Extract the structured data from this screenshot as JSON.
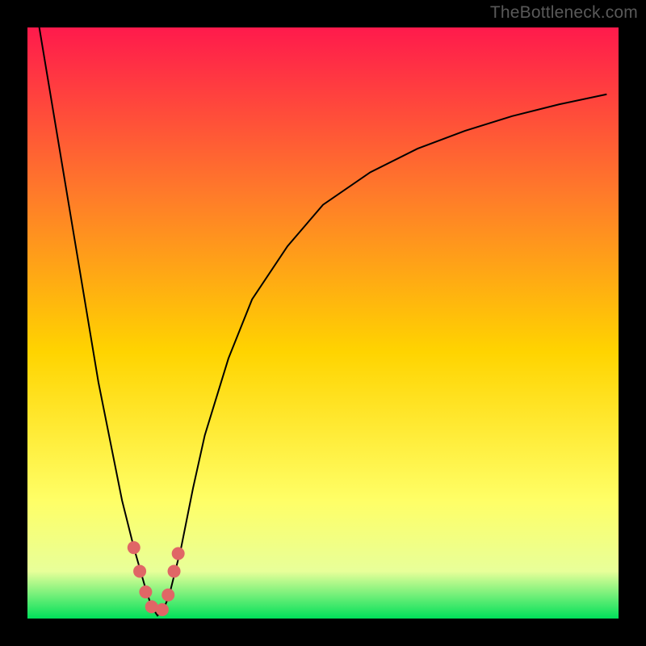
{
  "watermark": "TheBottleneck.com",
  "chart_data": {
    "type": "line",
    "title": "",
    "xlabel": "",
    "ylabel": "",
    "xlim": [
      0,
      100
    ],
    "ylim": [
      0,
      100
    ],
    "background_gradient": {
      "top": "#ff1a4c",
      "upper_mid": "#ff7a2a",
      "mid": "#ffd400",
      "lower_mid": "#ffff66",
      "lower": "#e8ff99",
      "bottom": "#00e05a"
    },
    "series": [
      {
        "name": "bottleneck-curve",
        "x": [
          2,
          4,
          6,
          8,
          10,
          12,
          14,
          16,
          18,
          20,
          21,
          22,
          23,
          24,
          26,
          28,
          30,
          34,
          38,
          44,
          50,
          58,
          66,
          74,
          82,
          90,
          98
        ],
        "y": [
          100,
          88,
          76,
          64,
          52,
          40,
          30,
          20,
          12,
          5,
          2,
          0.5,
          1.5,
          4,
          12,
          22,
          31,
          44,
          54,
          63,
          70,
          75.5,
          79.5,
          82.5,
          85,
          87,
          88.7
        ],
        "stroke": "#000000",
        "stroke_width": 2
      }
    ],
    "markers": {
      "name": "highlight-markers",
      "color": "#e06666",
      "radius": 8,
      "points": [
        {
          "x": 18.0,
          "y": 12.0
        },
        {
          "x": 19.0,
          "y": 8.0
        },
        {
          "x": 20.0,
          "y": 4.5
        },
        {
          "x": 21.0,
          "y": 2.0
        },
        {
          "x": 22.8,
          "y": 1.5
        },
        {
          "x": 23.8,
          "y": 4.0
        },
        {
          "x": 24.8,
          "y": 8.0
        },
        {
          "x": 25.5,
          "y": 11.0
        }
      ]
    }
  }
}
